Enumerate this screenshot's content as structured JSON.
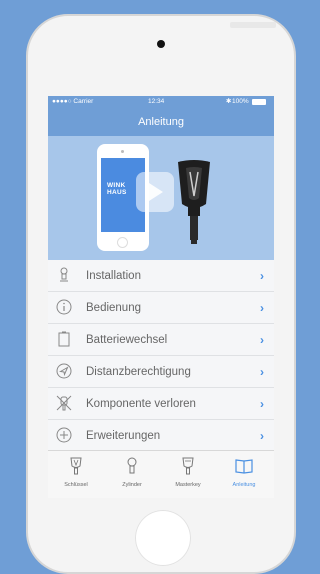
{
  "status_bar": {
    "carrier": "●●●●○ Carrier",
    "time": "12:34",
    "battery": "100%"
  },
  "nav": {
    "title": "Anleitung"
  },
  "hero": {
    "logo_line1": "WINK",
    "logo_line2": "HAUS"
  },
  "menu": [
    {
      "label": "Installation",
      "icon": "cylinder-icon"
    },
    {
      "label": "Bedienung",
      "icon": "info-icon"
    },
    {
      "label": "Batteriewechsel",
      "icon": "battery-icon"
    },
    {
      "label": "Distanzberechtigung",
      "icon": "location-arrow-icon"
    },
    {
      "label": "Komponente verloren",
      "icon": "crossed-key-icon"
    },
    {
      "label": "Erweiterungen",
      "icon": "plus-circle-icon"
    }
  ],
  "chevron": "›",
  "tabs": [
    {
      "label": "Schlüssel",
      "icon": "key-icon",
      "active": false
    },
    {
      "label": "Zylinder",
      "icon": "cylinder-icon",
      "active": false
    },
    {
      "label": "Masterkey",
      "icon": "masterkey-icon",
      "active": false
    },
    {
      "label": "Anleitung",
      "icon": "book-icon",
      "active": true
    }
  ],
  "colors": {
    "background": "#6f9ed6",
    "accent": "#4a90e2",
    "hero_bg": "#a7c6ea"
  }
}
